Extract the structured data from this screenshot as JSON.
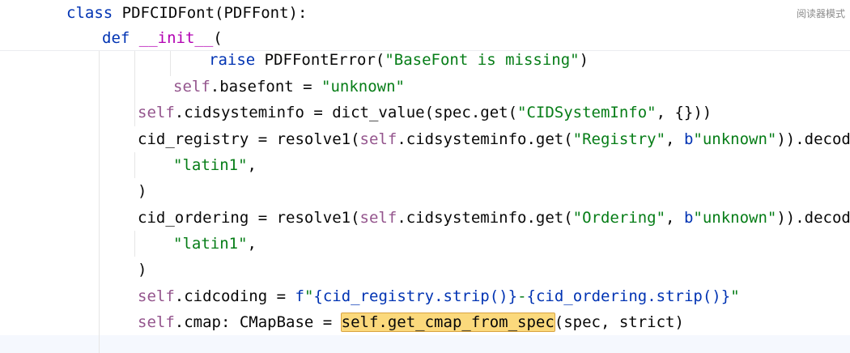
{
  "sticky": {
    "line1": {
      "kw": "class",
      "rest": " PDFCIDFont(PDFFont):"
    },
    "line2": {
      "kw": "def",
      "sp": " ",
      "dunder": "__init__",
      "rest": "("
    }
  },
  "reader_mode_label": "阅读器模式",
  "code": {
    "l1": {
      "a": "raise",
      "b": " PDFFontError(",
      "s": "\"BaseFont is missing\"",
      "c": ")"
    },
    "l2": {
      "self": "self",
      "a": ".basefont = ",
      "s": "\"unknown\""
    },
    "l3": {
      "self": "self",
      "a": ".cidsysteminfo = dict_value(spec.get(",
      "s": "\"CIDSystemInfo\"",
      "c": ", {}))"
    },
    "l4": {
      "a": "cid_registry = resolve1(",
      "self": "self",
      "b": ".cidsysteminfo.get(",
      "s": "\"Registry\"",
      "c": ", ",
      "bp": "b",
      "s2": "\"unknown\"",
      "d": ")).decode("
    },
    "l5": {
      "s": "\"latin1\"",
      "c": ","
    },
    "l6": {
      "a": ")"
    },
    "l7": {
      "a": "cid_ordering = resolve1(",
      "self": "self",
      "b": ".cidsysteminfo.get(",
      "s": "\"Ordering\"",
      "c": ", ",
      "bp": "b",
      "s2": "\"unknown\"",
      "d": ")).decode("
    },
    "l8": {
      "s": "\"latin1\"",
      "c": ","
    },
    "l9": {
      "a": ")"
    },
    "l10": {
      "self": "self",
      "a": ".cidcoding = ",
      "fp": "f",
      "s1": "\"",
      "e1": "{cid_registry.strip()}",
      "s2": "-",
      "e2": "{cid_ordering.strip()}",
      "s3": "\""
    },
    "l11": {
      "self": "self",
      "a": ".cmap: CMapBase = ",
      "hl": "self.get_cmap_from_spec",
      "b": "(spec, strict)"
    }
  }
}
